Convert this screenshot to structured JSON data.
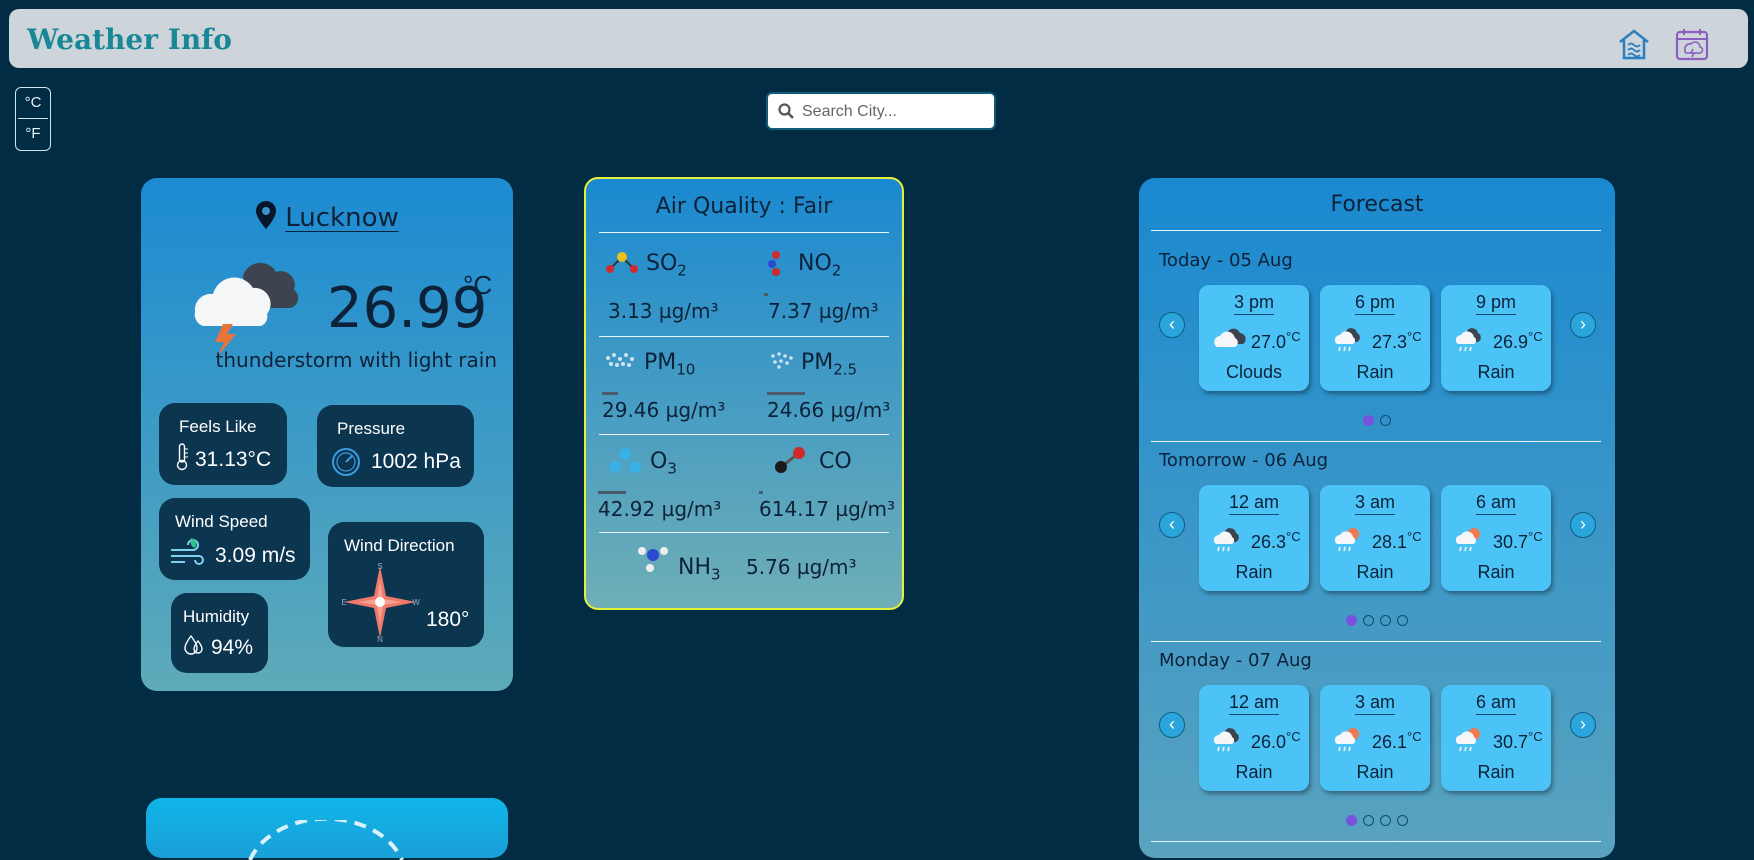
{
  "navbar": {
    "title": "Weather Info"
  },
  "units": {
    "celsius": "°C",
    "fahrenheit": "°F"
  },
  "search": {
    "placeholder": "Search City..."
  },
  "current": {
    "city": "Lucknow",
    "temperature": "26.99",
    "unit": "°C",
    "description": "thunderstorm with light rain",
    "feels_like": {
      "label": "Feels Like",
      "value": "31.13°C"
    },
    "pressure": {
      "label": "Pressure",
      "value": "1002 hPa"
    },
    "wind_speed": {
      "label": "Wind Speed",
      "value": "3.09 m/s"
    },
    "wind_direction": {
      "label": "Wind Direction",
      "value": "180°",
      "compass": [
        "S",
        "N",
        "E",
        "W"
      ]
    },
    "humidity": {
      "label": "Humidity",
      "value": "94%"
    }
  },
  "air_quality": {
    "title": "Air Quality :  Fair",
    "items": [
      {
        "name": "SO",
        "sub": "2",
        "value": "3.13 µg/m³"
      },
      {
        "name": "NO",
        "sub": "2",
        "value": "7.37 µg/m³"
      },
      {
        "name": "PM",
        "sub": "10",
        "value": "29.46 µg/m³"
      },
      {
        "name": "PM",
        "sub": "2.5",
        "value": "24.66 µg/m³"
      },
      {
        "name": "O",
        "sub": "3",
        "value": "42.92 µg/m³"
      },
      {
        "name": "CO",
        "sub": "",
        "value": "614.17 µg/m³"
      },
      {
        "name": "NH",
        "sub": "3",
        "value": "5.76 µg/m³"
      }
    ]
  },
  "forecast": {
    "title": "Forecast",
    "days": [
      {
        "label": "Today - 05 Aug",
        "hours": [
          {
            "time": "3 pm",
            "temp": "27.0",
            "unit": "°C",
            "cond": "Clouds",
            "icon": "cloud-icon"
          },
          {
            "time": "6 pm",
            "temp": "27.3",
            "unit": "°C",
            "cond": "Rain",
            "icon": "rain-icon"
          },
          {
            "time": "9 pm",
            "temp": "26.9",
            "unit": "°C",
            "cond": "Rain",
            "icon": "rain-icon"
          }
        ],
        "pages": 2
      },
      {
        "label": "Tomorrow - 06 Aug",
        "hours": [
          {
            "time": "12 am",
            "temp": "26.3",
            "unit": "°C",
            "cond": "Rain",
            "icon": "rain-icon"
          },
          {
            "time": "3 am",
            "temp": "28.1",
            "unit": "°C",
            "cond": "Rain",
            "icon": "sun-rain-icon"
          },
          {
            "time": "6 am",
            "temp": "30.7",
            "unit": "°C",
            "cond": "Rain",
            "icon": "sun-rain-icon"
          }
        ],
        "pages": 4
      },
      {
        "label": "Monday - 07 Aug",
        "hours": [
          {
            "time": "12 am",
            "temp": "26.0",
            "unit": "°C",
            "cond": "Rain",
            "icon": "rain-icon"
          },
          {
            "time": "3 am",
            "temp": "26.1",
            "unit": "°C",
            "cond": "Rain",
            "icon": "sun-rain-icon"
          },
          {
            "time": "6 am",
            "temp": "30.7",
            "unit": "°C",
            "cond": "Rain",
            "icon": "sun-rain-icon"
          }
        ],
        "pages": 4
      }
    ]
  }
}
